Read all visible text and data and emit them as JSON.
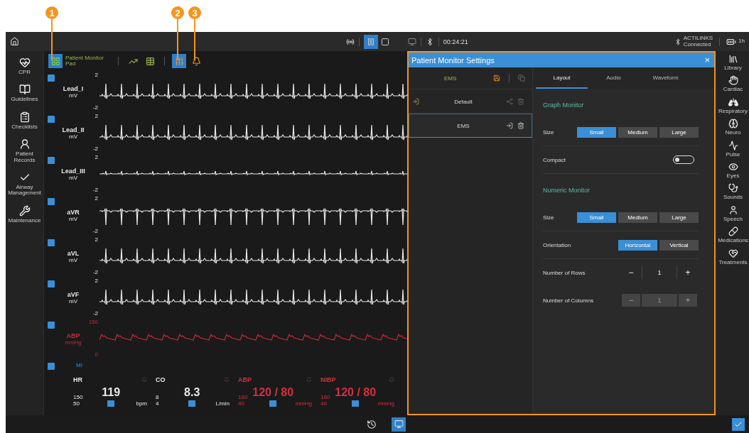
{
  "callouts": [
    {
      "label": "1"
    },
    {
      "label": "2"
    },
    {
      "label": "3"
    }
  ],
  "top_bar": {
    "playback": [
      {
        "kind": "pause",
        "selected": true
      },
      {
        "kind": "stop",
        "selected": false
      }
    ],
    "time": "00:24:21",
    "device": {
      "name": "ACTILINKS",
      "status": "Connected"
    },
    "battery": "1h"
  },
  "left_sidebar": [
    {
      "kind": "cpr",
      "label": "CPR"
    },
    {
      "kind": "guidelines",
      "label": "Guidelines"
    },
    {
      "kind": "checklists",
      "label": "Checklists"
    },
    {
      "kind": "records",
      "label": "Patient Records"
    },
    {
      "kind": "airway",
      "label": "Airway Management"
    },
    {
      "kind": "maintenance",
      "label": "Maintenance"
    }
  ],
  "monitor": {
    "toolbar": [
      {
        "kind": "pad",
        "selected": true,
        "label": "Patient Monitor Pad"
      },
      {
        "kind": "trend",
        "selected": false
      },
      {
        "kind": "table",
        "selected": false
      },
      {
        "kind": "ecg",
        "selected": true
      },
      {
        "kind": "alarm",
        "selected": false
      }
    ],
    "waveforms": [
      {
        "label": "Lead_I",
        "unit": "mV",
        "max": "2",
        "min": "-2",
        "kind": "upright",
        "color": "#e8e8e8"
      },
      {
        "label": "Lead_II",
        "unit": "mV",
        "max": "2",
        "min": "-2",
        "kind": "upright",
        "color": "#e8e8e8"
      },
      {
        "label": "Lead_III",
        "unit": "mV",
        "max": "2",
        "min": "-2",
        "kind": "small",
        "color": "#e8e8e8"
      },
      {
        "label": "aVR",
        "unit": "mV",
        "max": "2",
        "min": "-2",
        "kind": "inverted",
        "color": "#e8e8e8"
      },
      {
        "label": "aVL",
        "unit": "mV",
        "max": "2",
        "min": "-2",
        "kind": "upright",
        "color": "#e8e8e8"
      },
      {
        "label": "aVF",
        "unit": "mV",
        "max": "2",
        "min": "-2",
        "kind": "upright",
        "color": "#e8e8e8"
      },
      {
        "label": "ABP",
        "unit": "mmHg",
        "max": "150",
        "min": "0",
        "kind": "pressure",
        "color": "#c8283a"
      }
    ],
    "extra_channel": {
      "label": "MI"
    },
    "numerics": [
      {
        "label": "HR",
        "color": "#e8e8e8",
        "value": "119",
        "unit": "bpm",
        "upper": "150",
        "lower": "50"
      },
      {
        "label": "CO",
        "color": "#e8e8e8",
        "value": "8.3",
        "unit": "L/min",
        "upper": "8",
        "lower": "4"
      },
      {
        "label": "ABP",
        "color": "#d23040",
        "value": "120 / 80",
        "unit": "mmHg",
        "upper": "160",
        "lower": "40"
      },
      {
        "label": "NIBP",
        "color": "#d23040",
        "value": "120 / 80",
        "unit": "mmHg",
        "upper": "160",
        "lower": "40"
      }
    ]
  },
  "dialog": {
    "title": "Patient Monitor Settings",
    "close": "×",
    "profile_header": "EMS",
    "profiles": [
      {
        "label": "Default",
        "selected": false,
        "default": true
      },
      {
        "label": "EMS",
        "selected": true,
        "default": false
      }
    ],
    "tabs": [
      {
        "label": "Layout",
        "selected": true
      },
      {
        "label": "Audio",
        "selected": false
      },
      {
        "label": "Waveform",
        "selected": false
      }
    ],
    "settings": [
      {
        "kind": "heading",
        "label": "Graph Monitor"
      },
      {
        "kind": "segmented",
        "label": "Size",
        "options": [
          {
            "label": "Small",
            "selected": true
          },
          {
            "label": "Medium",
            "selected": false
          },
          {
            "label": "Large",
            "selected": false
          }
        ]
      },
      {
        "kind": "toggle",
        "label": "Compact",
        "on": false
      },
      {
        "kind": "heading",
        "label": "Numeric Monitor"
      },
      {
        "kind": "segmented",
        "label": "Size",
        "options": [
          {
            "label": "Small",
            "selected": true
          },
          {
            "label": "Medium",
            "selected": false
          },
          {
            "label": "Large",
            "selected": false
          }
        ]
      },
      {
        "kind": "segmented",
        "label": "Orientation",
        "options": [
          {
            "label": "Horizontal",
            "selected": true
          },
          {
            "label": "Vertical",
            "selected": false
          }
        ]
      },
      {
        "kind": "stepper",
        "label": "Number of Rows",
        "value": "1",
        "decrement": "−",
        "increment": "+",
        "disabled": false
      },
      {
        "kind": "stepper",
        "label": "Number of Columns",
        "value": "1",
        "decrement": "−",
        "increment": "+",
        "disabled": true
      }
    ]
  },
  "right_sidebar": [
    {
      "kind": "library",
      "label": "Library"
    },
    {
      "kind": "cardiac",
      "label": "Cardiac"
    },
    {
      "kind": "respiratory",
      "label": "Respiratory"
    },
    {
      "kind": "neuro",
      "label": "Neuro"
    },
    {
      "kind": "pulse",
      "label": "Pulse"
    },
    {
      "kind": "eyes",
      "label": "Eyes"
    },
    {
      "kind": "sounds",
      "label": "Sounds"
    },
    {
      "kind": "speech",
      "label": "Speech"
    },
    {
      "kind": "medications",
      "label": "Medications"
    },
    {
      "kind": "treatments",
      "label": "Treatments"
    }
  ]
}
